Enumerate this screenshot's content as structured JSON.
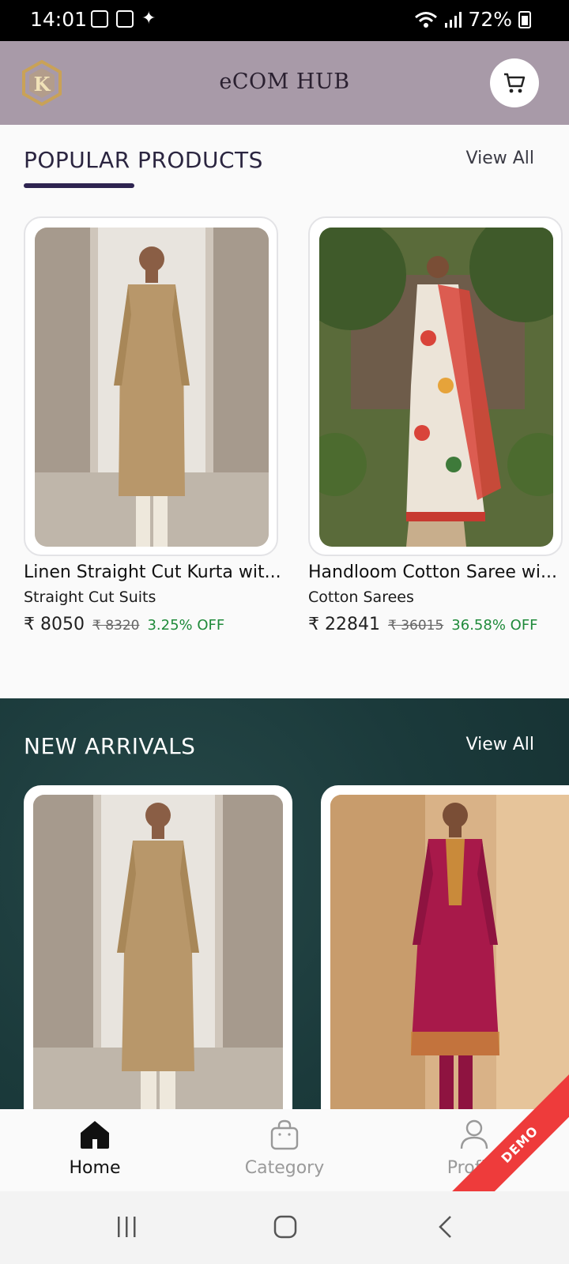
{
  "status_bar": {
    "time": "14:01",
    "battery": "72%"
  },
  "header": {
    "brand": "eCOM HUB",
    "logo_letter": "K"
  },
  "popular": {
    "title": "POPULAR PRODUCTS",
    "view_all": "View All",
    "products": [
      {
        "name": "Linen Straight Cut Kurta wit...",
        "category": "Straight Cut Suits",
        "price": "₹ 8050",
        "mrp": "₹ 8320",
        "discount": "3.25% OFF"
      },
      {
        "name": "Handloom Cotton Saree wi...",
        "category": "Cotton Sarees",
        "price": "₹ 22841",
        "mrp": "₹ 36015",
        "discount": "36.58% OFF"
      }
    ]
  },
  "arrivals": {
    "title": "NEW ARRIVALS",
    "view_all": "View All"
  },
  "bottom_nav": {
    "home": "Home",
    "category": "Category",
    "profile": "Profile"
  },
  "demo_ribbon": "DEMO",
  "colors": {
    "header_bg": "#a89aa8",
    "accent": "#2e2450",
    "discount": "#1f8a3a",
    "arrivals_bg": "#1b3a3b",
    "demo": "#ee3b3b"
  }
}
